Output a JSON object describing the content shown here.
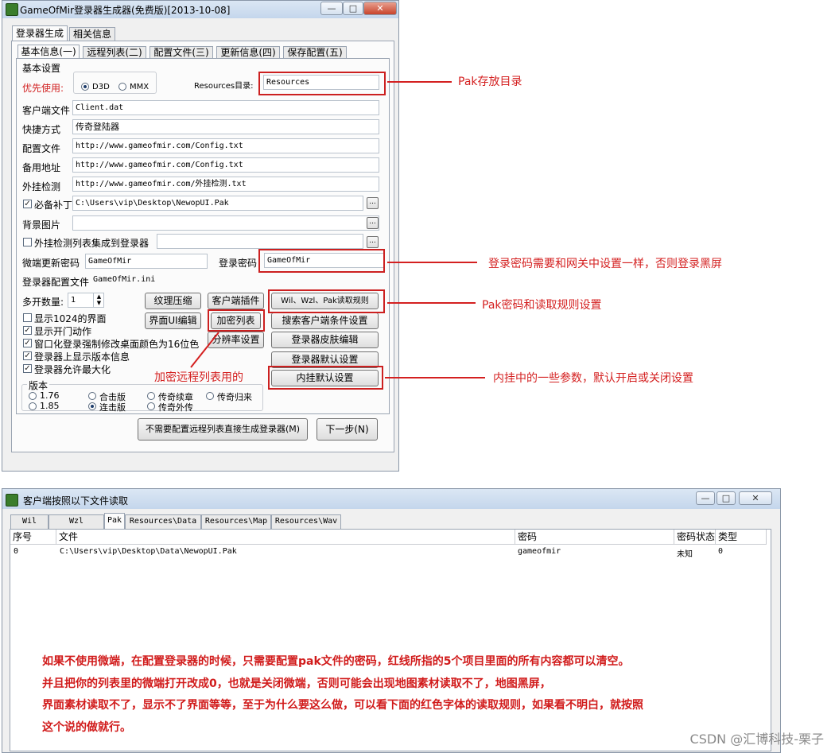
{
  "window1": {
    "title": "GameOfMir登录器生成器(免费版)[2013-10-08]",
    "outer_tabs": [
      "登录器生成",
      "相关信息"
    ],
    "inner_tabs": [
      "基本信息(一)",
      "远程列表(二)",
      "配置文件(三)",
      "更新信息(四)",
      "保存配置(五)"
    ],
    "basic_settings": "基本设置",
    "priority_label": "优先使用:",
    "render_options": [
      "D3D",
      "MMX"
    ],
    "resources_label": "Resources目录:",
    "resources_value": "Resources",
    "fields": [
      {
        "label": "客户端文件",
        "value": "Client.dat"
      },
      {
        "label": "快捷方式",
        "value": "传奇登陆器"
      },
      {
        "label": "配置文件",
        "value": "http://www.gameofmir.com/Config.txt"
      },
      {
        "label": "备用地址",
        "value": "http://www.gameofmir.com/Config.txt"
      },
      {
        "label": "外挂检测",
        "value": "http://www.gameofmir.com/外挂检测.txt"
      }
    ],
    "required_patch_label": "必备补丁",
    "required_patch_value": "C:\\Users\\vip\\Desktop\\NewopUI.Pak",
    "background_label": "背景图片",
    "plugin_check_label": "外挂检测列表集成到登录器",
    "ellipsis": "...",
    "micro_update_label": "微端更新密码",
    "micro_update_value": "GameOfMir",
    "login_password_label": "登录密码",
    "login_password_value": "GameOfMir",
    "config_file_label": "登录器配置文件",
    "config_file_value": "GameOfMir.ini",
    "multi_open_label": "多开数量:",
    "multi_open_value": "1",
    "options": [
      {
        "label": "显示1024的界面",
        "checked": false
      },
      {
        "label": "显示开门动作",
        "checked": true
      },
      {
        "label": "窗口化登录强制修改桌面颜色为16位色",
        "checked": true
      },
      {
        "label": "登录器上显示版本信息",
        "checked": true
      },
      {
        "label": "登录器允许最大化",
        "checked": true
      }
    ],
    "buttons": {
      "texture_compress": "纹理压缩",
      "client_plugin": "客户端插件",
      "wil_rules": "Wil、Wzl、Pak读取规则",
      "ui_edit": "界面UI编辑",
      "encrypt_list": "加密列表",
      "search_condition": "搜索客户端条件设置",
      "resolution": "分辨率设置",
      "skin_edit": "登录器皮肤编辑",
      "default_settings": "登录器默认设置",
      "builtin_defaults": "内挂默认设置",
      "generate_direct": "不需要配置远程列表直接生成登录器(M)",
      "next": "下一步(N)"
    },
    "version_group": "版本",
    "versions": [
      {
        "label": "1.76",
        "selected": false
      },
      {
        "label": "合击版",
        "selected": false
      },
      {
        "label": "传奇续章",
        "selected": false
      },
      {
        "label": "传奇归来",
        "selected": false
      },
      {
        "label": "1.85",
        "selected": false
      },
      {
        "label": "连击版",
        "selected": true
      },
      {
        "label": "传奇外传",
        "selected": false
      }
    ]
  },
  "annotations": {
    "pak_dir": "Pak存放目录",
    "login_password": "登录密码需要和网关中设置一样，否则登录黑屏",
    "pak_rules": "Pak密码和读取规则设置",
    "builtin": "内挂中的一些参数，默认开启或关闭设置",
    "encrypt_remote": "加密远程列表用的"
  },
  "window2": {
    "title": "客户端按照以下文件读取",
    "tabs": [
      "Wil",
      "Wzl",
      "Pak",
      "Resources\\Data",
      "Resources\\Map",
      "Resources\\Wav"
    ],
    "columns": [
      "序号",
      "文件",
      "密码",
      "密码状态",
      "类型"
    ],
    "rows": [
      {
        "index": "0",
        "file": "C:\\Users\\vip\\Desktop\\Data\\NewopUI.Pak",
        "password": "gameofmir",
        "status": "未知",
        "type": "0"
      }
    ],
    "note_lines": [
      "如果不使用微端，在配置登录器的时候，只需要配置pak文件的密码，红线所指的5个项目里面的所有内容都可以清空。",
      "并且把你的列表里的微端打开改成0，也就是关闭微端，否则可能会出现地图素材读取不了，地图黑屏，",
      "界面素材读取不了，显示不了界面等等，至于为什么要这么做，可以看下面的红色字体的读取规则，如果看不明白，就按照",
      "这个说的做就行。"
    ]
  },
  "watermark": "CSDN @汇博科技-栗子",
  "colors": {
    "annotation_red": "#d42020",
    "title_bar": "#c4d6ec"
  }
}
